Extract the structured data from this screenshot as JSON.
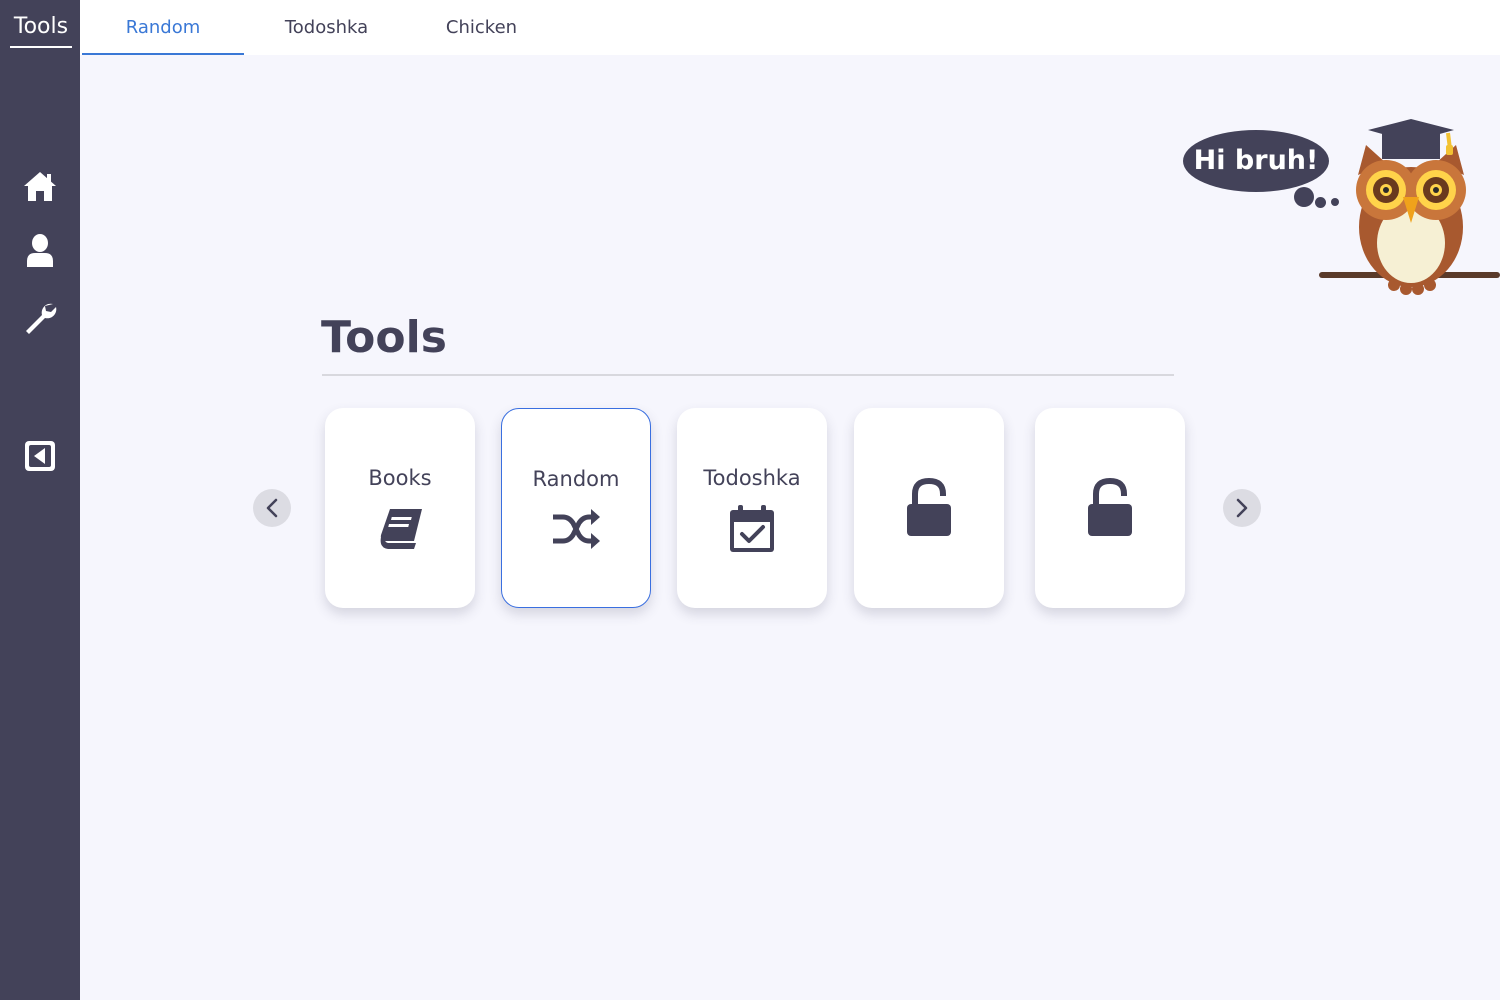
{
  "app": {
    "brand": "Tools"
  },
  "sidebar": {
    "icons": [
      {
        "name": "home-icon"
      },
      {
        "name": "user-icon"
      },
      {
        "name": "wrench-icon"
      },
      {
        "name": "collapse-icon"
      }
    ]
  },
  "tabs": [
    {
      "label": "Random",
      "active": true
    },
    {
      "label": "Todoshka",
      "active": false
    },
    {
      "label": "Chicken",
      "active": false
    }
  ],
  "main": {
    "title": "Tools",
    "cards": [
      {
        "label": "Books",
        "icon": "book-icon",
        "selected": false
      },
      {
        "label": "Random",
        "icon": "shuffle-icon",
        "selected": true
      },
      {
        "label": "Todoshka",
        "icon": "calendar-check-icon",
        "selected": false
      },
      {
        "label": "",
        "icon": "unlock-icon",
        "selected": false
      },
      {
        "label": "",
        "icon": "unlock-icon",
        "selected": false
      }
    ]
  },
  "mascot": {
    "speech": "Hi bruh!",
    "icon": "owl-graduate-icon"
  },
  "colors": {
    "sidebar": "#434259",
    "accent": "#3a78d6",
    "background": "#f6f6fd",
    "text": "#434259"
  }
}
